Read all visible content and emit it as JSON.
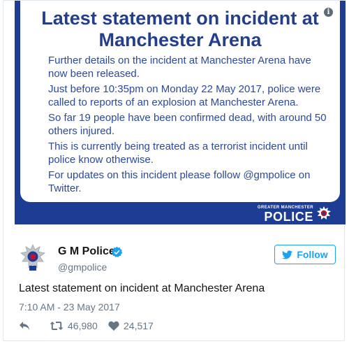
{
  "statement": {
    "title_line1": "Latest statement on incident at",
    "title_line2": "Manchester Arena",
    "paragraphs": [
      "Further details on the incident at Manchester Arena have now been released.",
      "Just before 10:35pm on Monday 22 May 2017, police were called to reports of an explosion at Manchester Arena.",
      "So far 19 people have been confirmed dead, with around 50 others injured.",
      "This is currently being treated as a terrorist incident until police know otherwise.",
      "For updates on this incident please follow @gmpolice on Twitter."
    ],
    "logo_small": "GREATER MANCHESTER",
    "logo_big": "POLICE",
    "info_glyph": "i"
  },
  "tweet": {
    "display_name": "G M Police",
    "handle": "@gmpolice",
    "follow_label": "Follow",
    "text": "Latest statement on incident at Manchester Arena",
    "timestamp": "7:10 AM - 23 May 2017",
    "retweets": "46,980",
    "likes": "24,517"
  },
  "colors": {
    "statement_blue": "#1c3d93",
    "twitter_blue": "#1da1f2",
    "text_gray": "#657786"
  },
  "icons": [
    "info-icon",
    "police-badge-icon",
    "verified-icon",
    "twitter-bird-icon",
    "reply-icon",
    "retweet-icon",
    "heart-icon"
  ]
}
